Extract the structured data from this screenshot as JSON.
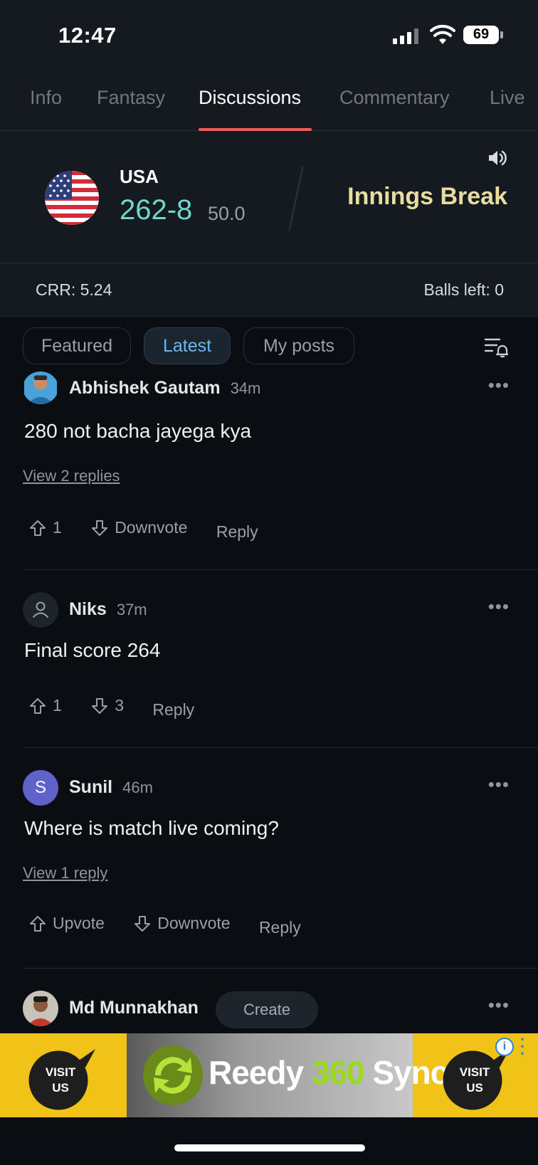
{
  "status_bar": {
    "time": "12:47",
    "battery": "69"
  },
  "tabs": [
    {
      "label": "Info"
    },
    {
      "label": "Fantasy"
    },
    {
      "label": "Discussions"
    },
    {
      "label": "Commentary"
    },
    {
      "label": "Live"
    }
  ],
  "active_tab": "Discussions",
  "score": {
    "team": "USA",
    "runs": "262-8",
    "overs": "50.0",
    "match_status": "Innings Break",
    "crr": "CRR:  5.24",
    "balls_left": "Balls left: 0"
  },
  "filters": [
    {
      "label": "Featured"
    },
    {
      "label": "Latest"
    },
    {
      "label": "My posts"
    }
  ],
  "active_filter": "Latest",
  "posts": [
    {
      "author": "Abhishek Gautam",
      "time": "34m",
      "text": "280 not bacha jayega kya",
      "replies": "View 2 replies",
      "upvote": "1",
      "downvote": "Downvote",
      "reply": "Reply"
    },
    {
      "author": "Niks",
      "time": "37m",
      "text": "Final score 264",
      "upvote": "1",
      "downvote": "3",
      "reply": "Reply"
    },
    {
      "author": "Sunil",
      "time": "46m",
      "avatar_letter": "S",
      "text": "Where is match live coming?",
      "replies": "View 1 reply",
      "upvote": "Upvote",
      "downvote": "Downvote",
      "reply": "Reply"
    },
    {
      "author": "Md Munnakhan"
    }
  ],
  "create_button": "Create",
  "ad": {
    "brand_part1": "Reedy ",
    "brand_part2": "360",
    "brand_part3": " Sync",
    "cta_line1": "VISIT",
    "cta_line2": "US"
  },
  "colors": {
    "accent_tab": "#ef5c5c",
    "runs": "#6fd8c9",
    "innings": "#e9dca0",
    "active_chip_text": "#6fb6ee",
    "ad_yellow": "#f1c319"
  }
}
